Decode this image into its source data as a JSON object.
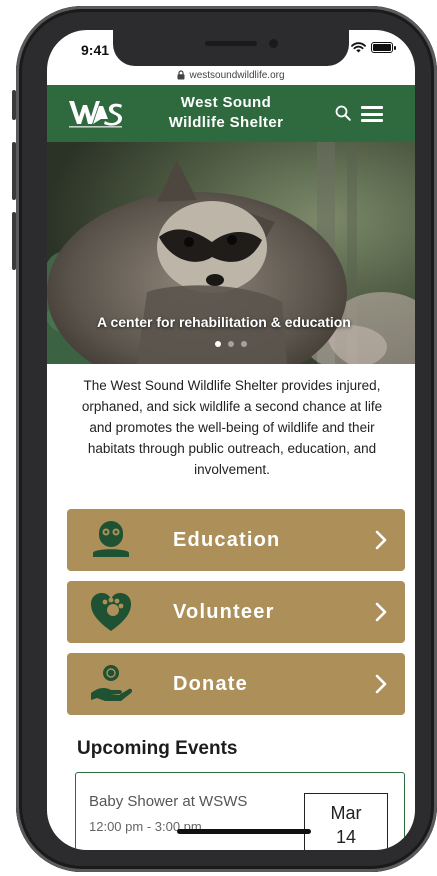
{
  "status": {
    "time": "9:41"
  },
  "browser": {
    "url": "westsoundwildlife.org"
  },
  "header": {
    "logo_text": "WAS",
    "title_line1": "West Sound",
    "title_line2": "Wildlife Shelter"
  },
  "hero": {
    "caption": "A center for rehabilitation & education",
    "slide_count": 3,
    "active_slide": 0
  },
  "mission": "The West Sound Wildlife Shelter provides injured, orphaned, and sick wildlife a second chance at life and promotes the well-being of wildlife and their habitats through public outreach, education, and involvement.",
  "actions": [
    {
      "label": "Education",
      "icon": "owl-icon"
    },
    {
      "label": "Volunteer",
      "icon": "heart-icon"
    },
    {
      "label": "Donate",
      "icon": "hand-coin-icon"
    }
  ],
  "events": {
    "title": "Upcoming Events",
    "items": [
      {
        "title": "Baby Shower at WSWS",
        "time": "12:00 pm - 3:00 pm",
        "month": "Mar",
        "day": "14"
      }
    ]
  },
  "colors": {
    "brand_green": "#2e6a3e",
    "tan": "#ad8f5a",
    "dark_green_icon": "#1f5233"
  }
}
